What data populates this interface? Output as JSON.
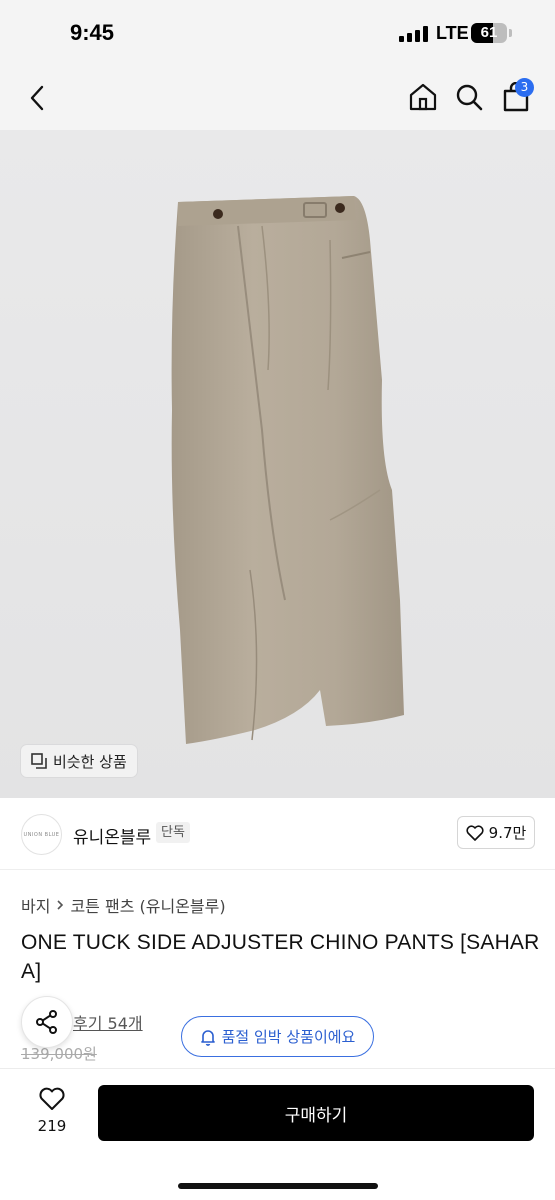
{
  "status_bar": {
    "time": "9:45",
    "network": "LTE",
    "battery": "61",
    "battery_level": 0.61
  },
  "header": {
    "back_icon": "chevron-left-icon",
    "home_icon": "home-icon",
    "search_icon": "search-icon",
    "cart_icon": "shopping-bag-icon",
    "cart_badge": "3",
    "accent_color": "#2b6df0"
  },
  "product_image": {
    "similar_button": "비슷한 상품",
    "similar_icon": "copy-icon"
  },
  "seller": {
    "logo_text": "UNION BLUE",
    "name": "유니온블루",
    "tag": "단독",
    "likes": "9.7만"
  },
  "breadcrumb": {
    "category": "바지",
    "subcategory": "코튼 팬츠 (유니온블루)"
  },
  "product": {
    "title": "ONE TUCK SIDE ADJUSTER CHINO PANTS [SAHARA]",
    "reviews": "후기 54개",
    "original_price": "139,000원",
    "stock_alert": "품절 임박 상품이에요"
  },
  "bottom_bar": {
    "wish_count": "219",
    "buy_label": "구매하기"
  }
}
